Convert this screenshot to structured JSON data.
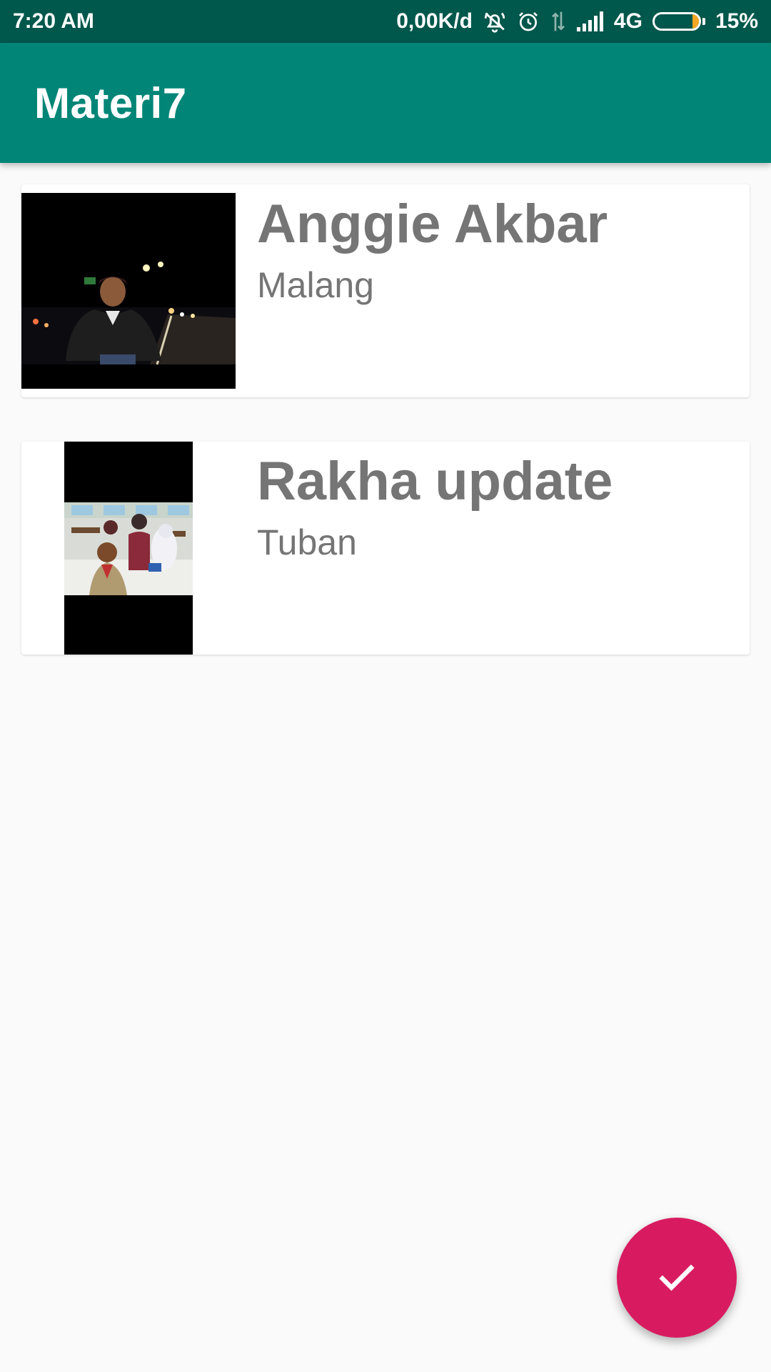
{
  "status_bar": {
    "time": "7:20 AM",
    "network_speed": "0,00K/d",
    "network_type": "4G",
    "battery_percent": "15%",
    "battery_level": 0.15,
    "icons": [
      "mute-icon",
      "alarm-icon",
      "data-arrows-icon",
      "signal-icon",
      "battery-icon"
    ]
  },
  "app_bar": {
    "title": "Materi7",
    "color": "#008577"
  },
  "list": {
    "items": [
      {
        "name": "Anggie Akbar",
        "city": "Malang",
        "photo": "night-street-portrait"
      },
      {
        "name": "Rakha update",
        "city": "Tuban",
        "photo": "classroom-group-photo"
      }
    ]
  },
  "fab": {
    "icon": "check-icon",
    "color": "#d81b60"
  }
}
